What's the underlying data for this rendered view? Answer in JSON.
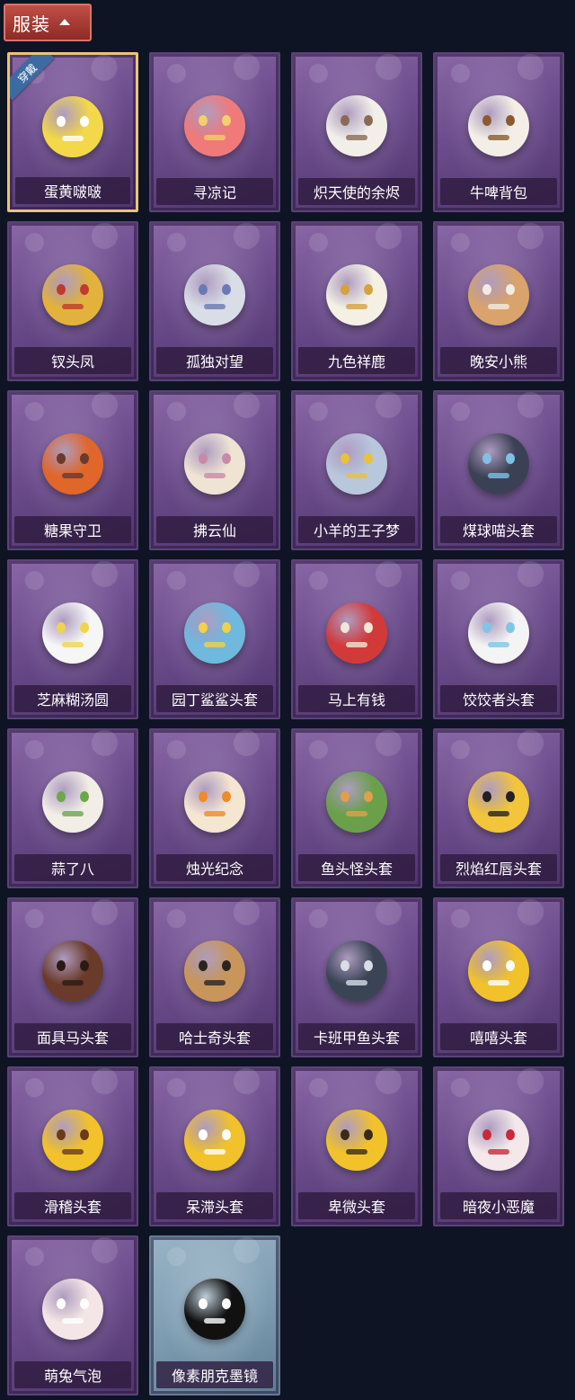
{
  "header": {
    "title": "服装"
  },
  "badge": {
    "equipped": "穿戴"
  },
  "items": [
    {
      "label": "蛋黄啵啵",
      "icon": "yellow-chick-egg",
      "color": "#f3d84a",
      "accent": "#ffffff",
      "selected": true,
      "equipped": true,
      "frame": "purple"
    },
    {
      "label": "寻凉记",
      "icon": "pink-bear-straw-hat",
      "color": "#f07a7a",
      "accent": "#f2d06a",
      "frame": "purple"
    },
    {
      "label": "炽天使的余烬",
      "icon": "angel-doll",
      "color": "#f2efe8",
      "accent": "#8a6a54",
      "frame": "purple"
    },
    {
      "label": "牛啤背包",
      "icon": "cow-beer-barrel",
      "color": "#f4efe6",
      "accent": "#8c5a2e",
      "frame": "purple"
    },
    {
      "label": "钗头凤",
      "icon": "phoenix-crown-doll",
      "color": "#e2b23c",
      "accent": "#c23a2a",
      "frame": "purple"
    },
    {
      "label": "孤独对望",
      "icon": "white-hair-doll",
      "color": "#d9dde6",
      "accent": "#6b79b5",
      "frame": "purple"
    },
    {
      "label": "九色祥鹿",
      "icon": "deer-charm",
      "color": "#f4f0e4",
      "accent": "#d3a33e",
      "frame": "purple"
    },
    {
      "label": "晚安小熊",
      "icon": "teddy-bear-charm",
      "color": "#d9a36b",
      "accent": "#f2ece2",
      "frame": "purple"
    },
    {
      "label": "糖果守卫",
      "icon": "pumpkin-scarecrow",
      "color": "#e0662a",
      "accent": "#6a3a2a",
      "frame": "purple"
    },
    {
      "label": "拂云仙",
      "icon": "immortal-doll",
      "color": "#efe4d4",
      "accent": "#c88aa8",
      "frame": "purple"
    },
    {
      "label": "小羊的王子梦",
      "icon": "sheep-crown-head",
      "color": "#b9c7dc",
      "accent": "#e8c23a",
      "frame": "purple"
    },
    {
      "label": "煤球喵头套",
      "icon": "black-cat-head",
      "color": "#3b4155",
      "accent": "#7fc0e6",
      "frame": "purple"
    },
    {
      "label": "芝麻糊汤圆",
      "icon": "dumpling-head",
      "color": "#f6f6f6",
      "accent": "#f2d44a",
      "frame": "purple"
    },
    {
      "label": "园丁鲨鲨头套",
      "icon": "shark-head",
      "color": "#6fb8de",
      "accent": "#f2d04a",
      "frame": "purple"
    },
    {
      "label": "马上有钱",
      "icon": "red-horse-head",
      "color": "#d23a3a",
      "accent": "#f2e6d8",
      "frame": "purple"
    },
    {
      "label": "饺饺者头套",
      "icon": "cloud-dumpling-head",
      "color": "#f4f4f4",
      "accent": "#7fc6e6",
      "frame": "purple"
    },
    {
      "label": "蒜了八",
      "icon": "garlic-head",
      "color": "#f2eee6",
      "accent": "#6aa84a",
      "frame": "purple"
    },
    {
      "label": "烛光纪念",
      "icon": "candle-head",
      "color": "#f5e6d2",
      "accent": "#f08a2a",
      "frame": "purple"
    },
    {
      "label": "鱼头怪头套",
      "icon": "fish-mask",
      "color": "#6aa04a",
      "accent": "#e0a04a",
      "frame": "purple"
    },
    {
      "label": "烈焰红唇头套",
      "icon": "pikachu-mask",
      "color": "#f2c53a",
      "accent": "#222222",
      "frame": "purple"
    },
    {
      "label": "面具马头套",
      "icon": "horse-mask",
      "color": "#6a3a2a",
      "accent": "#2a1a14",
      "frame": "purple"
    },
    {
      "label": "哈士奇头套",
      "icon": "husky-mask",
      "color": "#c8965a",
      "accent": "#2a2420",
      "frame": "purple"
    },
    {
      "label": "卡班甲鱼头套",
      "icon": "turtle-head",
      "color": "#3a4455",
      "accent": "#d8dde6",
      "frame": "purple"
    },
    {
      "label": "嘻嘻头套",
      "icon": "grin-emoji-head",
      "color": "#f2c22a",
      "accent": "#ffffff",
      "frame": "purple"
    },
    {
      "label": "滑稽头套",
      "icon": "smirk-emoji-head",
      "color": "#f2c22a",
      "accent": "#6a3a1a",
      "frame": "purple"
    },
    {
      "label": "呆滞头套",
      "icon": "blank-emoji-head",
      "color": "#f2c22a",
      "accent": "#ffffff",
      "frame": "purple"
    },
    {
      "label": "卑微头套",
      "icon": "pleading-emoji-head",
      "color": "#f2c22a",
      "accent": "#3a2a1a",
      "frame": "purple"
    },
    {
      "label": "暗夜小恶魔",
      "icon": "little-devil-head",
      "color": "#f4e8ea",
      "accent": "#c82a3a",
      "frame": "purple"
    },
    {
      "label": "萌兔气泡",
      "icon": "bunny-bubble-head",
      "color": "#f4e6e6",
      "accent": "#ffffff",
      "frame": "purple"
    },
    {
      "label": "像素朋克墨镜",
      "icon": "pixel-sunglasses",
      "color": "#111111",
      "accent": "#ffffff",
      "frame": "blue"
    }
  ]
}
